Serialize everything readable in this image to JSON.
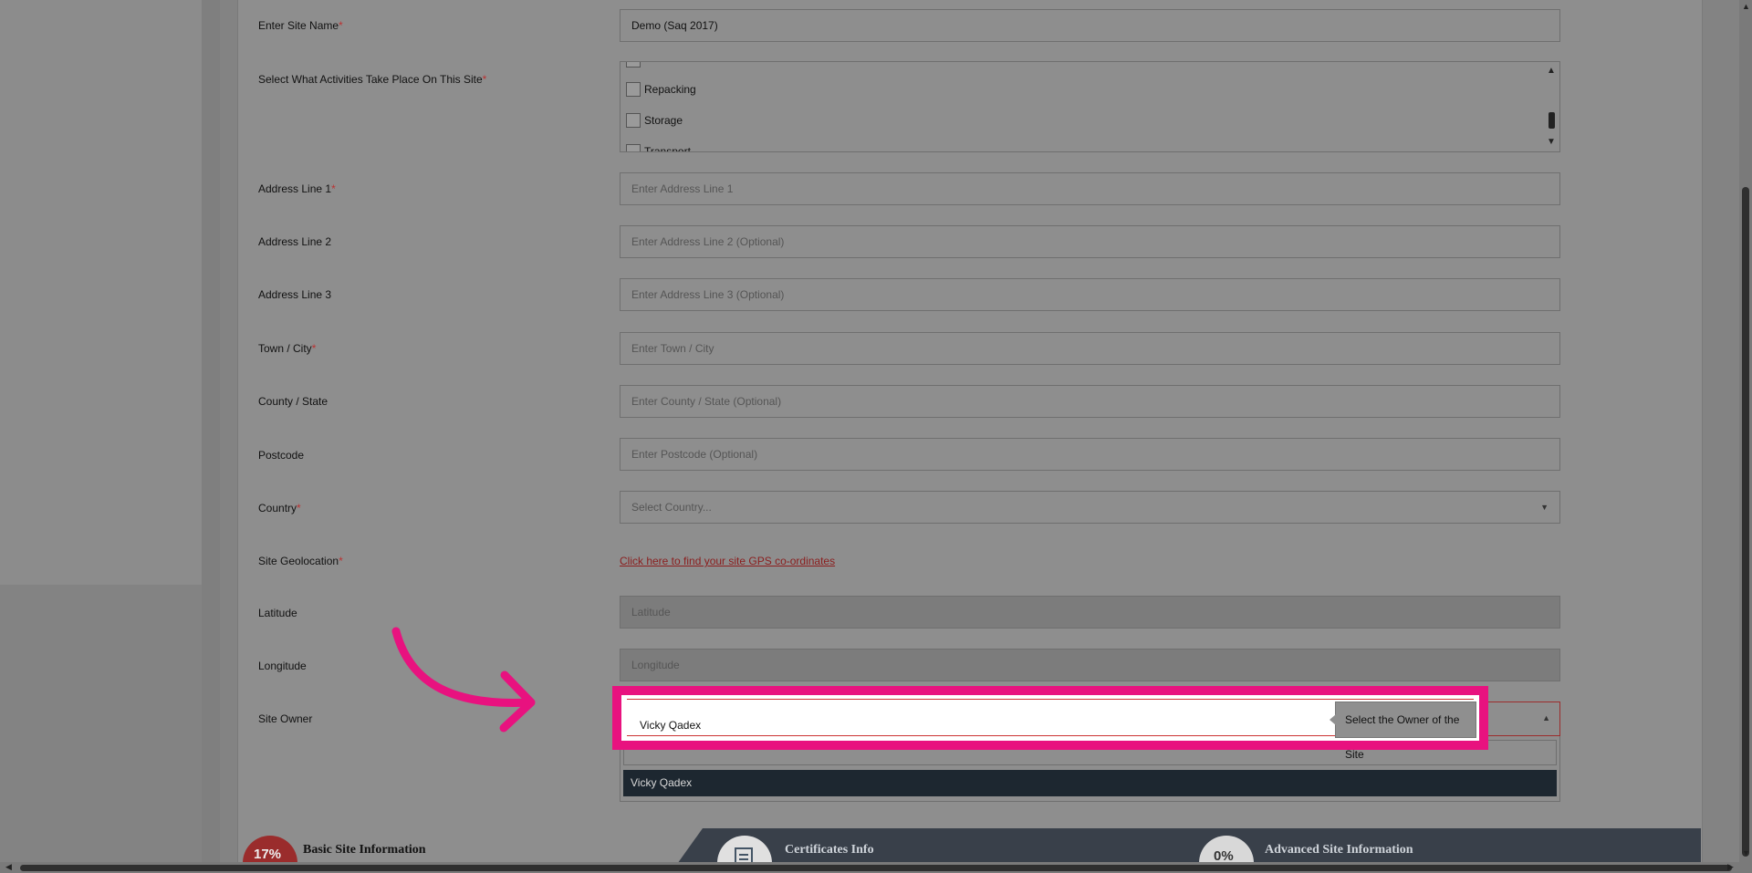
{
  "form": {
    "site_name": {
      "label": "Enter Site Name",
      "required": "*",
      "value": "Demo (Saq 2017)"
    },
    "activities": {
      "label": "Select What Activities Take Place On This Site",
      "required": "*",
      "items": [
        {
          "label": "Repacking"
        },
        {
          "label": "Storage"
        },
        {
          "label": "Transport"
        }
      ]
    },
    "address1": {
      "label": "Address Line 1",
      "required": "*",
      "placeholder": "Enter Address Line 1"
    },
    "address2": {
      "label": "Address Line 2",
      "placeholder": "Enter Address Line 2 (Optional)"
    },
    "address3": {
      "label": "Address Line 3",
      "placeholder": "Enter Address Line 3 (Optional)"
    },
    "town": {
      "label": "Town / City",
      "required": "*",
      "placeholder": "Enter Town / City"
    },
    "county": {
      "label": "County / State",
      "placeholder": "Enter County / State (Optional)"
    },
    "postcode": {
      "label": "Postcode",
      "placeholder": "Enter Postcode (Optional)"
    },
    "country": {
      "label": "Country",
      "required": "*",
      "placeholder": "Select Country..."
    },
    "geolocation": {
      "label": "Site Geolocation",
      "required": "*",
      "link": "Click here to find your site GPS co-ordinates"
    },
    "latitude": {
      "label": "Latitude",
      "placeholder": "Latitude"
    },
    "longitude": {
      "label": "Longitude",
      "placeholder": "Longitude"
    },
    "owner": {
      "label": "Site Owner",
      "value": "Vicky Qadex",
      "option": "Vicky Qadex",
      "tooltip": "Select the Owner of the Site"
    }
  },
  "steps": [
    {
      "percent": "17%",
      "title": "Basic Site Information"
    },
    {
      "title": "Certificates Info"
    },
    {
      "percent": "0%",
      "title": "Advanced Site Information"
    }
  ],
  "colors": {
    "highlight": "#e8127f",
    "link": "#8b1d1d",
    "option_bg": "#1d2730"
  }
}
